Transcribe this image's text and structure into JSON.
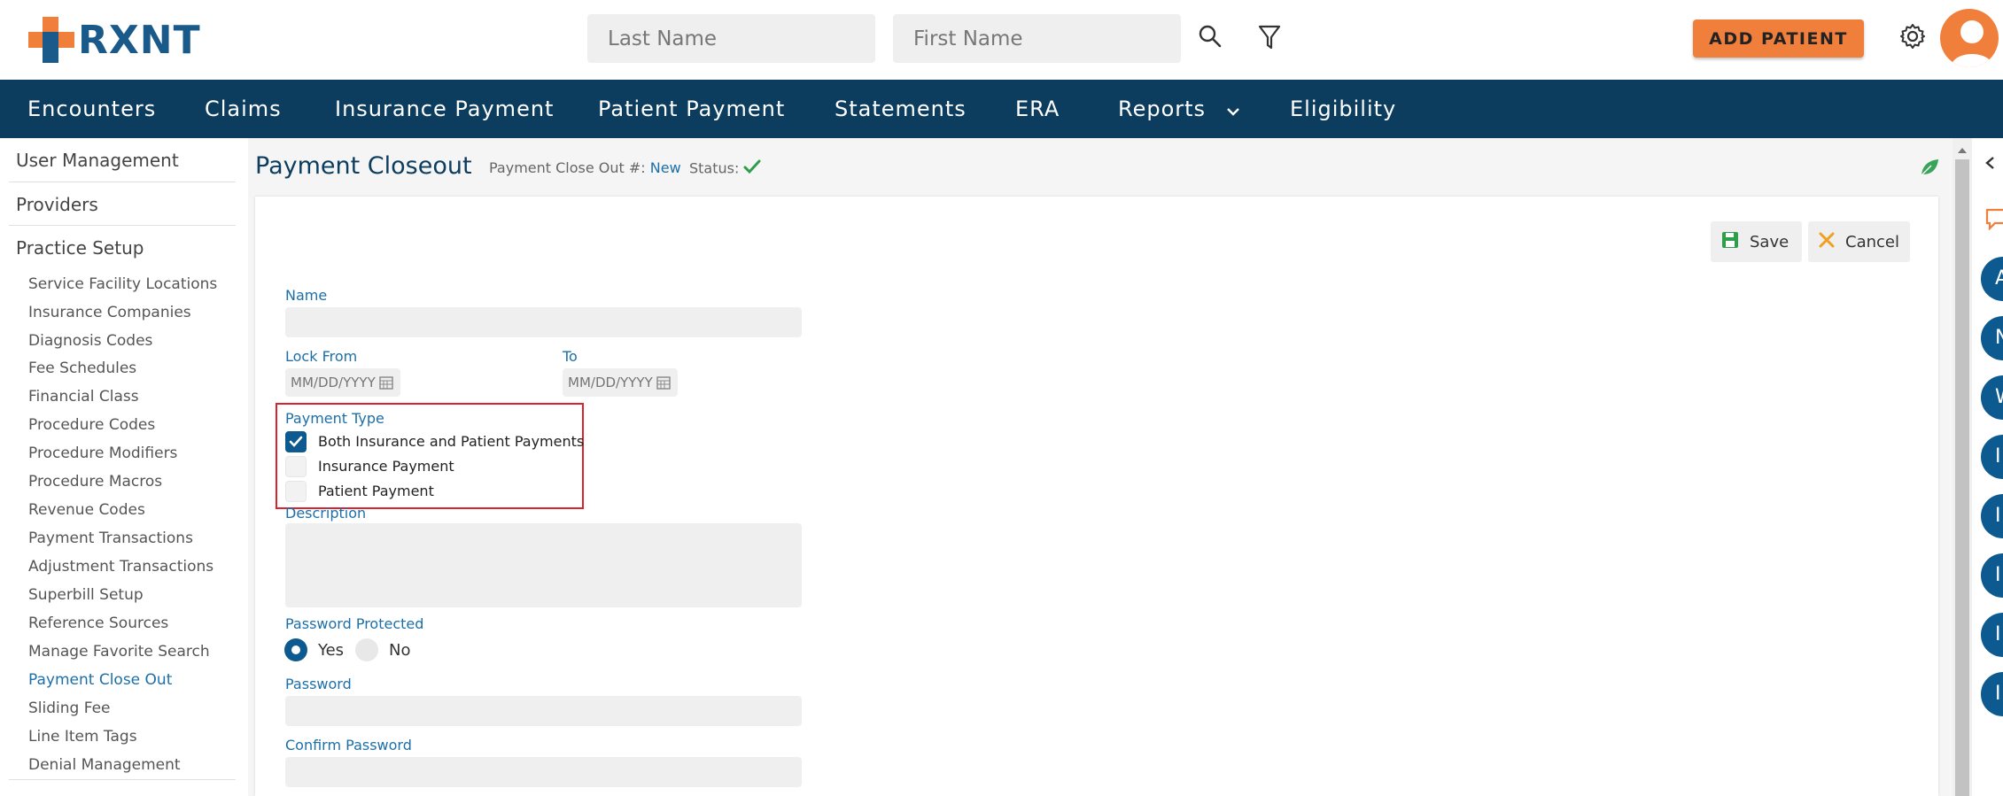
{
  "brand": {
    "name": "RXNT",
    "accent": "#f07f3c",
    "navy": "#0c3d5e",
    "link": "#1c6fa8"
  },
  "header": {
    "last_name_placeholder": "Last Name",
    "first_name_placeholder": "First Name",
    "search_icon": "search-icon",
    "filter_icon": "filter-icon",
    "add_patient_label": "ADD PATIENT",
    "settings_icon": "gear-icon"
  },
  "nav": {
    "items": [
      {
        "label": "Encounters"
      },
      {
        "label": "Claims"
      },
      {
        "label": "Insurance Payment"
      },
      {
        "label": "Patient Payment"
      },
      {
        "label": "Statements"
      },
      {
        "label": "ERA"
      },
      {
        "label": "Reports"
      },
      {
        "label": "Eligibility"
      }
    ]
  },
  "sidebar": {
    "sections": [
      {
        "label": "User Management"
      },
      {
        "label": "Providers"
      },
      {
        "label": "Practice Setup"
      }
    ],
    "links": [
      {
        "label": "Service Facility Locations"
      },
      {
        "label": "Insurance Companies"
      },
      {
        "label": "Diagnosis Codes"
      },
      {
        "label": "Fee Schedules"
      },
      {
        "label": "Financial Class"
      },
      {
        "label": "Procedure Codes"
      },
      {
        "label": "Procedure Modifiers"
      },
      {
        "label": "Procedure Macros"
      },
      {
        "label": "Revenue Codes"
      },
      {
        "label": "Payment Transactions"
      },
      {
        "label": "Adjustment Transactions"
      },
      {
        "label": "Superbill Setup"
      },
      {
        "label": "Reference Sources"
      },
      {
        "label": "Manage Favorite Search"
      },
      {
        "label": "Payment Close Out"
      },
      {
        "label": "Sliding Fee"
      },
      {
        "label": "Line Item Tags"
      },
      {
        "label": "Denial Management"
      }
    ],
    "active_link": "Payment Close Out"
  },
  "page": {
    "title": "Payment Closeout",
    "closeout_label": "Payment Close Out #:",
    "closeout_value": "New",
    "status_label": "Status:"
  },
  "actions": {
    "save_label": "Save",
    "cancel_label": "Cancel"
  },
  "form": {
    "name_label": "Name",
    "name_value": "",
    "lock_from_label": "Lock From",
    "lock_from_placeholder": "MM/DD/YYYY",
    "to_label": "To",
    "to_placeholder": "MM/DD/YYYY",
    "payment_type_label": "Payment Type",
    "payment_types": [
      {
        "label": "Both Insurance and Patient Payments",
        "checked": true
      },
      {
        "label": "Insurance Payment",
        "checked": false
      },
      {
        "label": "Patient Payment",
        "checked": false
      }
    ],
    "description_label": "Description",
    "password_protected_label": "Password Protected",
    "radio_yes": "Yes",
    "radio_no": "No",
    "password_protected_value": "Yes",
    "password_label": "Password",
    "confirm_password_label": "Confirm Password"
  },
  "right_strip": {
    "letters": [
      "A",
      "N",
      "W",
      "I",
      "I",
      "I",
      "I",
      "I"
    ]
  }
}
